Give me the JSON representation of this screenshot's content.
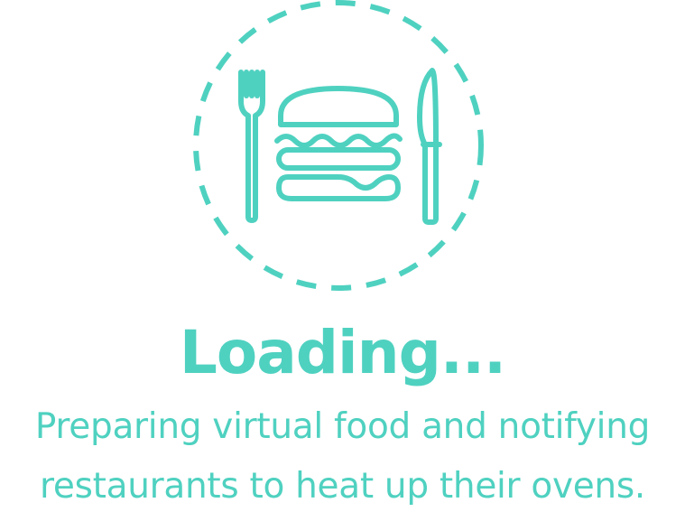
{
  "theme": {
    "accent": "#4fd1c0",
    "background": "#ffffff"
  },
  "icons": {
    "ring": "dashed-ring-icon",
    "fork": "fork-icon",
    "burger": "burger-icon",
    "knife": "knife-icon"
  },
  "loading": {
    "title": "Loading...",
    "message_line_1": "Preparing virtual food and notifying",
    "message_line_2": "restaurants to heat up their ovens."
  }
}
